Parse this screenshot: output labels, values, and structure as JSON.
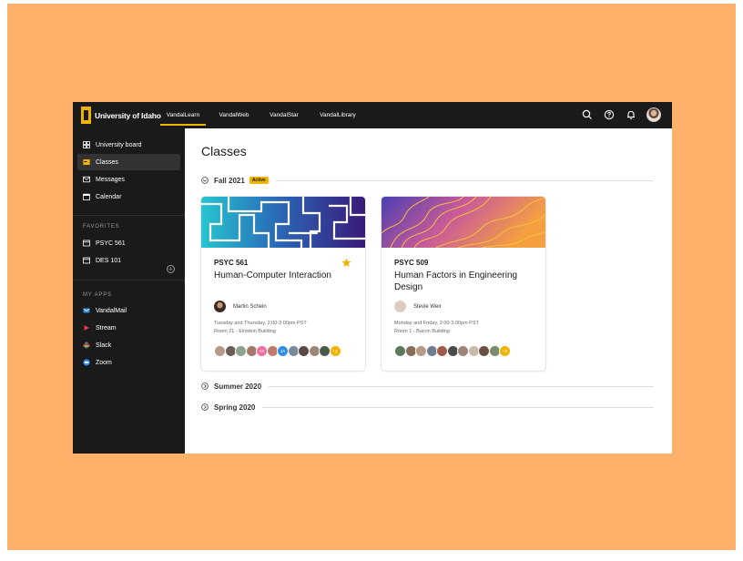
{
  "header": {
    "logo_text": "University of Idaho",
    "tabs": [
      {
        "label": "VandalLearn",
        "active": true
      },
      {
        "label": "VandalWeb",
        "active": false
      },
      {
        "label": "VandalStar",
        "active": false
      },
      {
        "label": "VandalLibrary",
        "active": false
      }
    ],
    "icons": [
      "search-icon",
      "help-icon",
      "bell-icon"
    ]
  },
  "sidebar": {
    "items": [
      {
        "label": "University board",
        "icon": "grid-icon"
      },
      {
        "label": "Classes",
        "icon": "classes-icon",
        "active": true
      },
      {
        "label": "Messages",
        "icon": "mail-icon"
      },
      {
        "label": "Calendar",
        "icon": "calendar-icon"
      }
    ],
    "favorites_heading": "FAVORITES",
    "favorites": [
      {
        "label": "PSYC 561",
        "icon": "window-icon"
      },
      {
        "label": "DES 101",
        "icon": "window-icon"
      }
    ],
    "apps_heading": "MY APPS",
    "apps": [
      {
        "label": "VandalMail",
        "icon": "mail-app-icon",
        "color": "#2f8fe6"
      },
      {
        "label": "Stream",
        "icon": "stream-icon",
        "color": "#e23a55"
      },
      {
        "label": "Slack",
        "icon": "slack-icon",
        "color": "#e0c14a"
      },
      {
        "label": "Zoom",
        "icon": "zoom-icon",
        "color": "#2d8cff"
      }
    ]
  },
  "main": {
    "title": "Classes",
    "sections": [
      {
        "label": "Fall 2021",
        "badge": "Active",
        "expanded": true
      },
      {
        "label": "Summer 2020",
        "expanded": false
      },
      {
        "label": "Spring 2020",
        "expanded": false
      }
    ],
    "cards": [
      {
        "code": "PSYC 561",
        "title": "Human-Computer Interaction",
        "favorite": true,
        "instructor": "Martin Schein",
        "schedule": "Tuesday and Thursday, 2:00-3:00pm PST",
        "room": "Room 21 - Einstein Building",
        "participant_initials": [
          "",
          "",
          "",
          "",
          "AA",
          "",
          "JA",
          "",
          "",
          "",
          "",
          "+3"
        ]
      },
      {
        "code": "PSYC 509",
        "title": "Human Factors in Engineering Design",
        "favorite": false,
        "instructor": "Stevie Weir",
        "schedule": "Monday and Friday, 2:00-3:00pm PST",
        "room": "Room 1 - Bacon Building",
        "participant_initials": [
          "",
          "",
          "",
          "",
          "",
          "",
          "",
          "",
          "",
          "",
          "+3"
        ]
      }
    ]
  },
  "colors": {
    "accent": "#F1B300",
    "page_bg": "#FFB16B",
    "chrome": "#1a1a1a"
  }
}
